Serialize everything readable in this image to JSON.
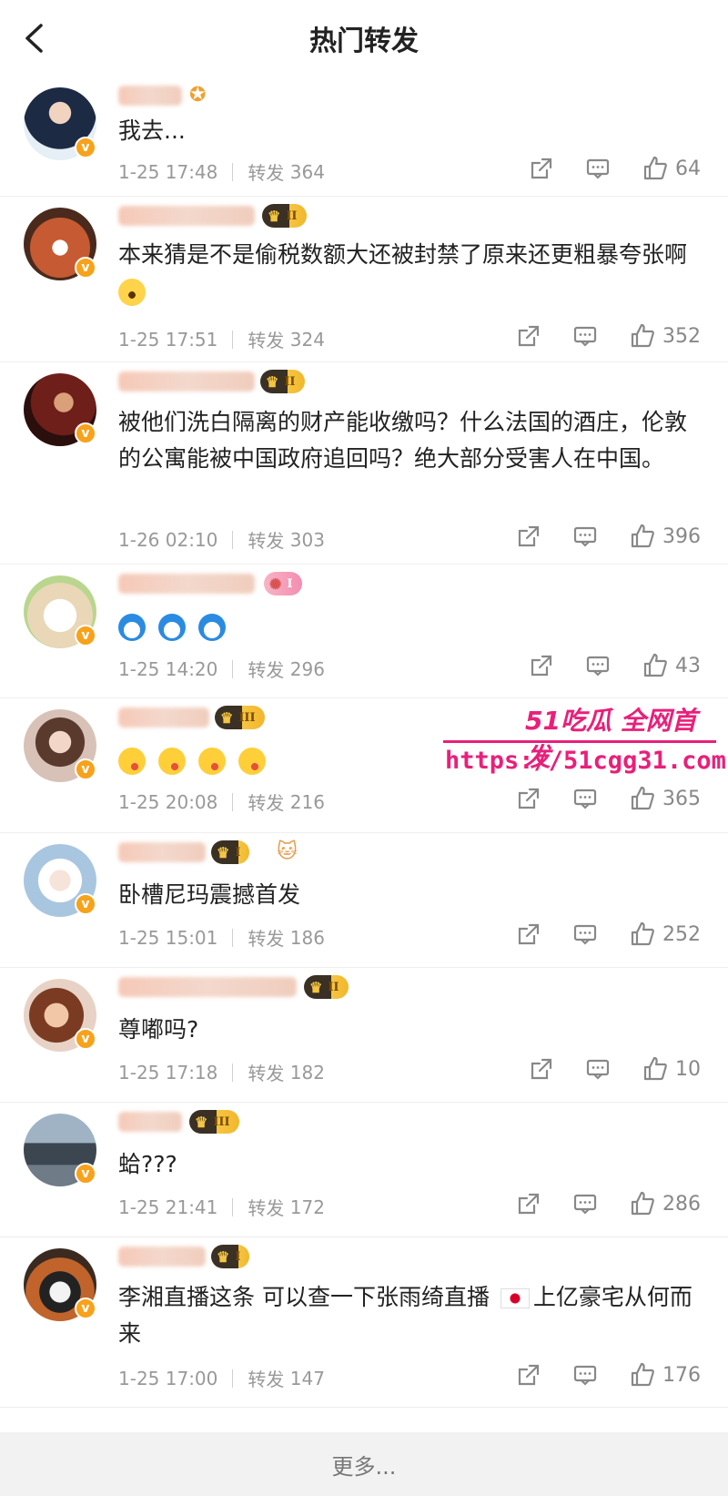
{
  "header": {
    "title": "热门转发"
  },
  "comments": [
    {
      "text": "我去...",
      "time": "1-25 17:48",
      "repost_label": "转发",
      "reposts": "364",
      "likes": "64",
      "level": "",
      "avatar_color": "#2b3a55"
    },
    {
      "text": "本来猜是不是偷税数额大还被封禁了原来还更粗暴夸张啊",
      "time": "1-25 17:51",
      "repost_label": "转发",
      "reposts": "324",
      "likes": "352",
      "level": "II",
      "avatar_color": "#c65a32"
    },
    {
      "text": "被他们洗白隔离的财产能收缴吗？什么法国的酒庄，伦敦的公寓能被中国政府追回吗？绝大部分受害人在中国。",
      "time": "1-26 02:10",
      "repost_label": "转发",
      "reposts": "303",
      "likes": "396",
      "level": "II",
      "avatar_color": "#6e1f1a"
    },
    {
      "text": "",
      "time": "1-25 14:20",
      "repost_label": "转发",
      "reposts": "296",
      "likes": "43",
      "level": "I",
      "avatar_color": "#e9d7b7"
    },
    {
      "text": "",
      "time": "1-25 20:08",
      "repost_label": "转发",
      "reposts": "216",
      "likes": "365",
      "level": "III",
      "avatar_color": "#d8c2b8"
    },
    {
      "text": "卧槽尼玛震撼首发",
      "time": "1-25 15:01",
      "repost_label": "转发",
      "reposts": "186",
      "likes": "252",
      "level": "I",
      "avatar_color": "#a9c6e0"
    },
    {
      "text": "尊嘟吗?",
      "time": "1-25 17:18",
      "repost_label": "转发",
      "reposts": "182",
      "likes": "10",
      "level": "II",
      "avatar_color": "#a8674a"
    },
    {
      "text": "蛤???",
      "time": "1-25 21:41",
      "repost_label": "转发",
      "reposts": "172",
      "likes": "286",
      "level": "III",
      "avatar_color": "#6f7b86"
    },
    {
      "text_a": "李湘直播这条 可以查一下张雨绮直播",
      "text_b": "上亿豪宅从何而来",
      "time": "1-25 17:00",
      "repost_label": "转发",
      "reposts": "147",
      "likes": "176",
      "level": "I",
      "avatar_color": "#c0642c"
    }
  ],
  "watermark": {
    "line1": "51吃瓜 全网首发",
    "line2": "https://51cgg31.com"
  },
  "more_label": "更多..."
}
